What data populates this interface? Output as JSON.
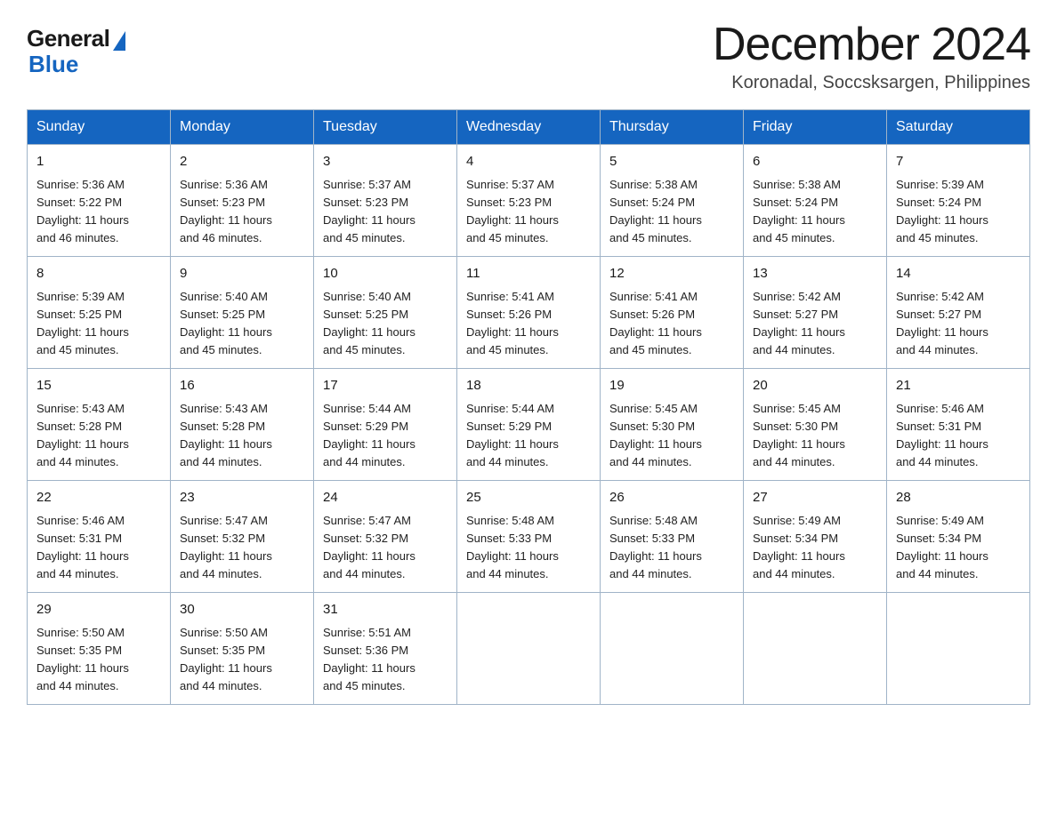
{
  "logo": {
    "general": "General",
    "blue": "Blue"
  },
  "title": "December 2024",
  "subtitle": "Koronadal, Soccsksargen, Philippines",
  "weekdays": [
    "Sunday",
    "Monday",
    "Tuesday",
    "Wednesday",
    "Thursday",
    "Friday",
    "Saturday"
  ],
  "weeks": [
    [
      {
        "day": 1,
        "sunrise": "5:36 AM",
        "sunset": "5:22 PM",
        "daylight": "11 hours and 46 minutes."
      },
      {
        "day": 2,
        "sunrise": "5:36 AM",
        "sunset": "5:23 PM",
        "daylight": "11 hours and 46 minutes."
      },
      {
        "day": 3,
        "sunrise": "5:37 AM",
        "sunset": "5:23 PM",
        "daylight": "11 hours and 45 minutes."
      },
      {
        "day": 4,
        "sunrise": "5:37 AM",
        "sunset": "5:23 PM",
        "daylight": "11 hours and 45 minutes."
      },
      {
        "day": 5,
        "sunrise": "5:38 AM",
        "sunset": "5:24 PM",
        "daylight": "11 hours and 45 minutes."
      },
      {
        "day": 6,
        "sunrise": "5:38 AM",
        "sunset": "5:24 PM",
        "daylight": "11 hours and 45 minutes."
      },
      {
        "day": 7,
        "sunrise": "5:39 AM",
        "sunset": "5:24 PM",
        "daylight": "11 hours and 45 minutes."
      }
    ],
    [
      {
        "day": 8,
        "sunrise": "5:39 AM",
        "sunset": "5:25 PM",
        "daylight": "11 hours and 45 minutes."
      },
      {
        "day": 9,
        "sunrise": "5:40 AM",
        "sunset": "5:25 PM",
        "daylight": "11 hours and 45 minutes."
      },
      {
        "day": 10,
        "sunrise": "5:40 AM",
        "sunset": "5:25 PM",
        "daylight": "11 hours and 45 minutes."
      },
      {
        "day": 11,
        "sunrise": "5:41 AM",
        "sunset": "5:26 PM",
        "daylight": "11 hours and 45 minutes."
      },
      {
        "day": 12,
        "sunrise": "5:41 AM",
        "sunset": "5:26 PM",
        "daylight": "11 hours and 45 minutes."
      },
      {
        "day": 13,
        "sunrise": "5:42 AM",
        "sunset": "5:27 PM",
        "daylight": "11 hours and 44 minutes."
      },
      {
        "day": 14,
        "sunrise": "5:42 AM",
        "sunset": "5:27 PM",
        "daylight": "11 hours and 44 minutes."
      }
    ],
    [
      {
        "day": 15,
        "sunrise": "5:43 AM",
        "sunset": "5:28 PM",
        "daylight": "11 hours and 44 minutes."
      },
      {
        "day": 16,
        "sunrise": "5:43 AM",
        "sunset": "5:28 PM",
        "daylight": "11 hours and 44 minutes."
      },
      {
        "day": 17,
        "sunrise": "5:44 AM",
        "sunset": "5:29 PM",
        "daylight": "11 hours and 44 minutes."
      },
      {
        "day": 18,
        "sunrise": "5:44 AM",
        "sunset": "5:29 PM",
        "daylight": "11 hours and 44 minutes."
      },
      {
        "day": 19,
        "sunrise": "5:45 AM",
        "sunset": "5:30 PM",
        "daylight": "11 hours and 44 minutes."
      },
      {
        "day": 20,
        "sunrise": "5:45 AM",
        "sunset": "5:30 PM",
        "daylight": "11 hours and 44 minutes."
      },
      {
        "day": 21,
        "sunrise": "5:46 AM",
        "sunset": "5:31 PM",
        "daylight": "11 hours and 44 minutes."
      }
    ],
    [
      {
        "day": 22,
        "sunrise": "5:46 AM",
        "sunset": "5:31 PM",
        "daylight": "11 hours and 44 minutes."
      },
      {
        "day": 23,
        "sunrise": "5:47 AM",
        "sunset": "5:32 PM",
        "daylight": "11 hours and 44 minutes."
      },
      {
        "day": 24,
        "sunrise": "5:47 AM",
        "sunset": "5:32 PM",
        "daylight": "11 hours and 44 minutes."
      },
      {
        "day": 25,
        "sunrise": "5:48 AM",
        "sunset": "5:33 PM",
        "daylight": "11 hours and 44 minutes."
      },
      {
        "day": 26,
        "sunrise": "5:48 AM",
        "sunset": "5:33 PM",
        "daylight": "11 hours and 44 minutes."
      },
      {
        "day": 27,
        "sunrise": "5:49 AM",
        "sunset": "5:34 PM",
        "daylight": "11 hours and 44 minutes."
      },
      {
        "day": 28,
        "sunrise": "5:49 AM",
        "sunset": "5:34 PM",
        "daylight": "11 hours and 44 minutes."
      }
    ],
    [
      {
        "day": 29,
        "sunrise": "5:50 AM",
        "sunset": "5:35 PM",
        "daylight": "11 hours and 44 minutes."
      },
      {
        "day": 30,
        "sunrise": "5:50 AM",
        "sunset": "5:35 PM",
        "daylight": "11 hours and 44 minutes."
      },
      {
        "day": 31,
        "sunrise": "5:51 AM",
        "sunset": "5:36 PM",
        "daylight": "11 hours and 45 minutes."
      },
      null,
      null,
      null,
      null
    ]
  ],
  "labels": {
    "sunrise": "Sunrise:",
    "sunset": "Sunset:",
    "daylight": "Daylight:"
  }
}
